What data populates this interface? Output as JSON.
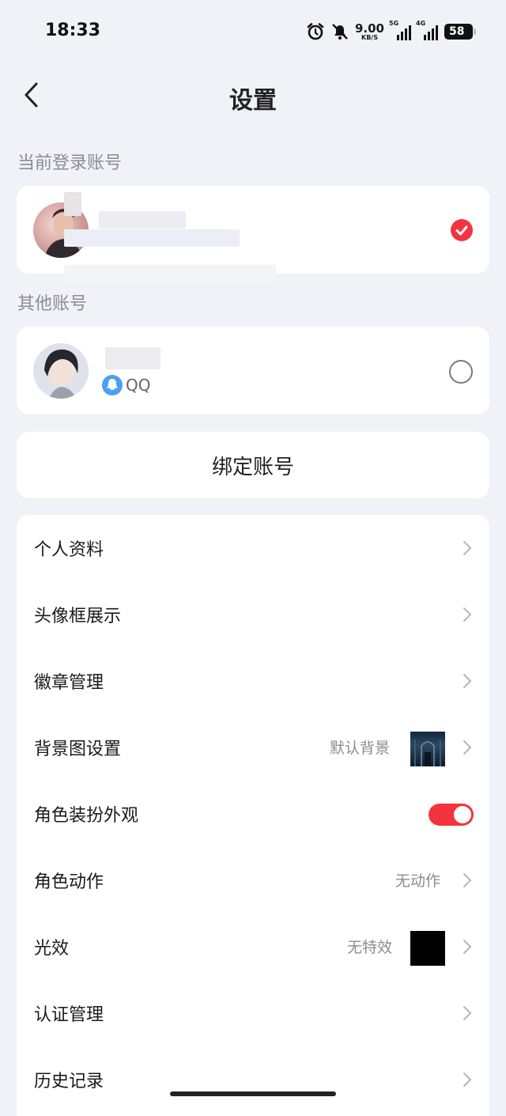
{
  "status": {
    "time": "18:33",
    "speed_value": "9.00",
    "speed_unit": "KB/S",
    "sim1_label": "5G",
    "sim2_label": "4G",
    "battery": "58"
  },
  "header": {
    "title": "设置"
  },
  "current_account": {
    "section_label": "当前登录账号",
    "selected": true
  },
  "other_accounts": {
    "section_label": "其他账号",
    "items": [
      {
        "platform": "QQ",
        "selected": false
      }
    ]
  },
  "bind_button": "绑定账号",
  "menu": [
    {
      "label": "个人资料"
    },
    {
      "label": "头像框展示"
    },
    {
      "label": "徽章管理"
    },
    {
      "label": "背景图设置",
      "value": "默认背景"
    },
    {
      "label": "角色装扮外观",
      "toggle_on": true
    },
    {
      "label": "角色动作",
      "value": "无动作"
    },
    {
      "label": "光效",
      "value": "无特效"
    },
    {
      "label": "认证管理"
    },
    {
      "label": "历史记录"
    }
  ],
  "colors": {
    "accent": "#f2343f",
    "qq_blue": "#4a9ff5",
    "background": "#f1f2f8"
  }
}
